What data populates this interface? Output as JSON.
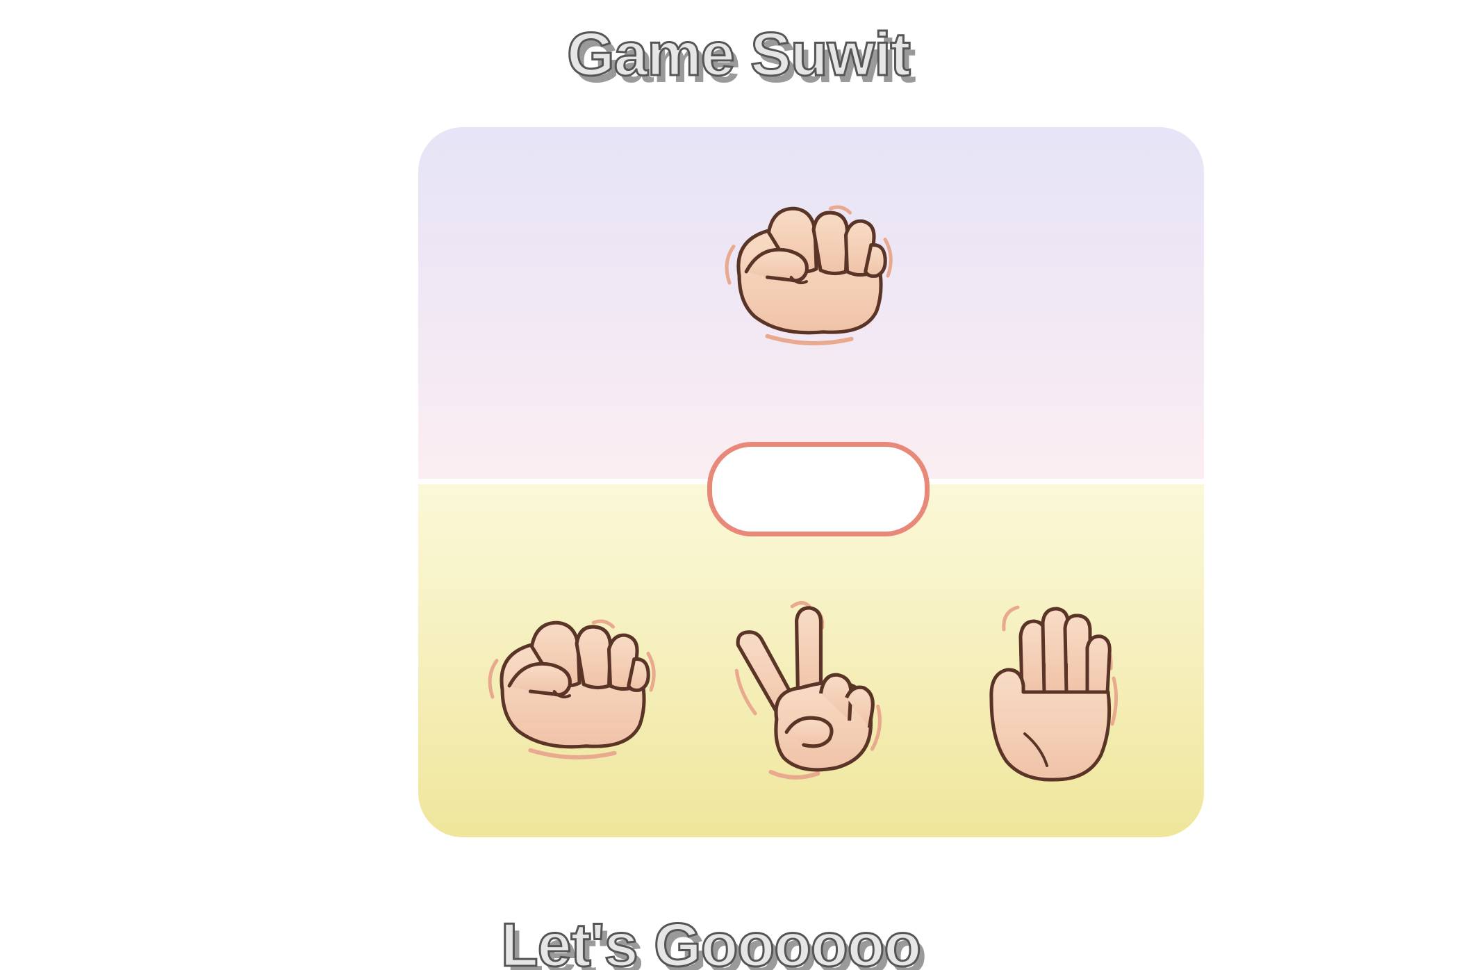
{
  "header": {
    "title": "Game Suwit"
  },
  "arena": {
    "computer_choice_icon": "rock-hand-icon",
    "result_text": "",
    "player_choices": [
      {
        "name": "rock",
        "icon": "rock-hand-icon"
      },
      {
        "name": "scissors",
        "icon": "scissors-hand-icon"
      },
      {
        "name": "paper",
        "icon": "paper-hand-icon"
      }
    ]
  },
  "footer": {
    "tagline": "Let's Goooooo"
  },
  "colors": {
    "computer_area_top": "#e6e4f6",
    "computer_area_bottom": "#fbeef2",
    "player_area_top": "#fbf8d8",
    "player_area_bottom": "#efe69b",
    "result_border": "#e88878",
    "skin": "#f5d2ba",
    "outline": "#5a3426",
    "motion_lines": "#e9a98f"
  }
}
